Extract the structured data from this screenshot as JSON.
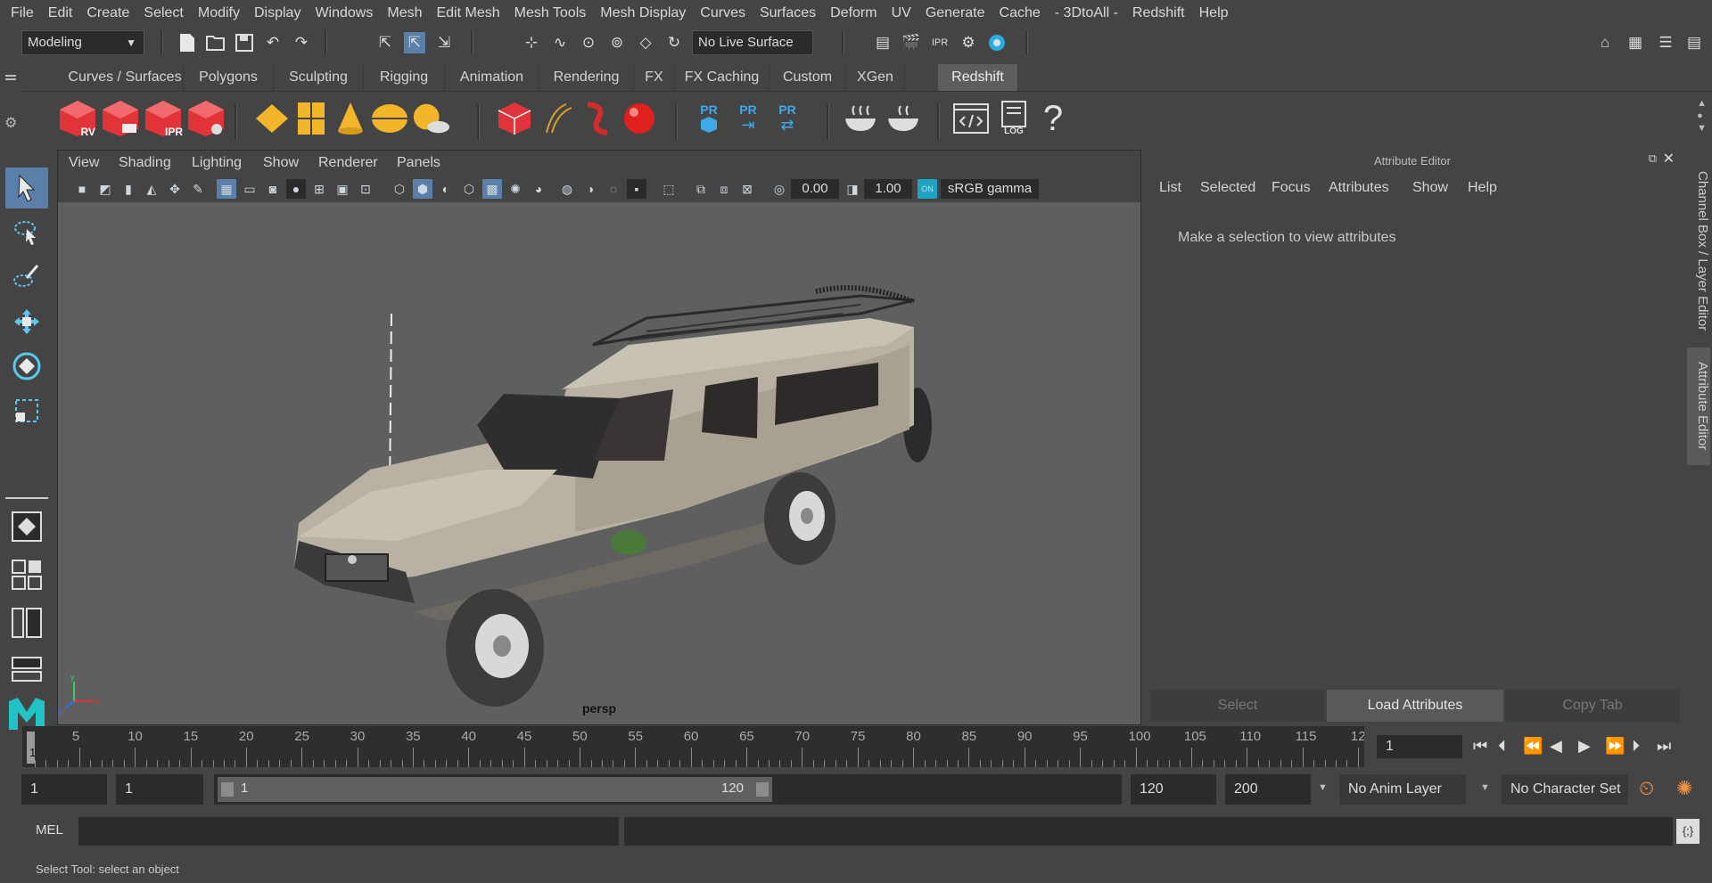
{
  "menus": [
    "File",
    "Edit",
    "Create",
    "Select",
    "Modify",
    "Display",
    "Windows",
    "Mesh",
    "Edit Mesh",
    "Mesh Tools",
    "Mesh Display",
    "Curves",
    "Surfaces",
    "Deform",
    "UV",
    "Generate",
    "Cache",
    "- 3DtoAll -",
    "Redshift",
    "Help"
  ],
  "status": {
    "mode": "Modeling",
    "live_surface": "No Live Surface"
  },
  "shelf_tabs": [
    "Curves / Surfaces",
    "Polygons",
    "Sculpting",
    "Rigging",
    "Animation",
    "Rendering",
    "FX",
    "FX Caching",
    "Custom",
    "XGen",
    "Redshift"
  ],
  "shelf_active": "Redshift",
  "shelf_labels": {
    "rv": "RV",
    "ipr": "IPR",
    "pr1": "PR",
    "pr2": "PR",
    "pr3": "PR",
    "log": "LOG",
    "help": "?"
  },
  "viewport": {
    "menus": [
      "View",
      "Shading",
      "Lighting",
      "Show",
      "Renderer",
      "Panels"
    ],
    "exposure": "0.00",
    "gamma": "1.00",
    "color_space": "sRGB gamma",
    "camera": "persp"
  },
  "attribute_editor": {
    "title": "Attribute Editor",
    "menus": [
      "List",
      "Selected",
      "Focus",
      "Attributes",
      "Show",
      "Help"
    ],
    "message": "Make a selection to view attributes",
    "buttons": [
      "Select",
      "Load Attributes",
      "Copy Tab"
    ]
  },
  "side_tabs": [
    "Channel Box / Layer Editor",
    "Attribute Editor"
  ],
  "timeline": {
    "ticks": [
      5,
      10,
      15,
      20,
      25,
      30,
      35,
      40,
      45,
      50,
      55,
      60,
      65,
      70,
      75,
      80,
      85,
      90,
      95,
      100,
      105,
      110,
      115,
      12
    ],
    "first": "1",
    "current_frame": "1"
  },
  "range": {
    "start": "1",
    "inner_start": "1",
    "slider_start": "1",
    "slider_end": "120",
    "end": "120",
    "outer_end": "200",
    "anim_layer": "No Anim Layer",
    "char_set": "No Character Set"
  },
  "command": {
    "lang": "MEL"
  },
  "help_line": "Select Tool: select an object",
  "colors": {
    "bg": "#444444",
    "viewport": "#5f5f5f",
    "redshift_red": "#e0343a",
    "accent_yellow": "#f3b52a",
    "pr_blue": "#3fa8e6",
    "maya_teal": "#21c3c7"
  }
}
